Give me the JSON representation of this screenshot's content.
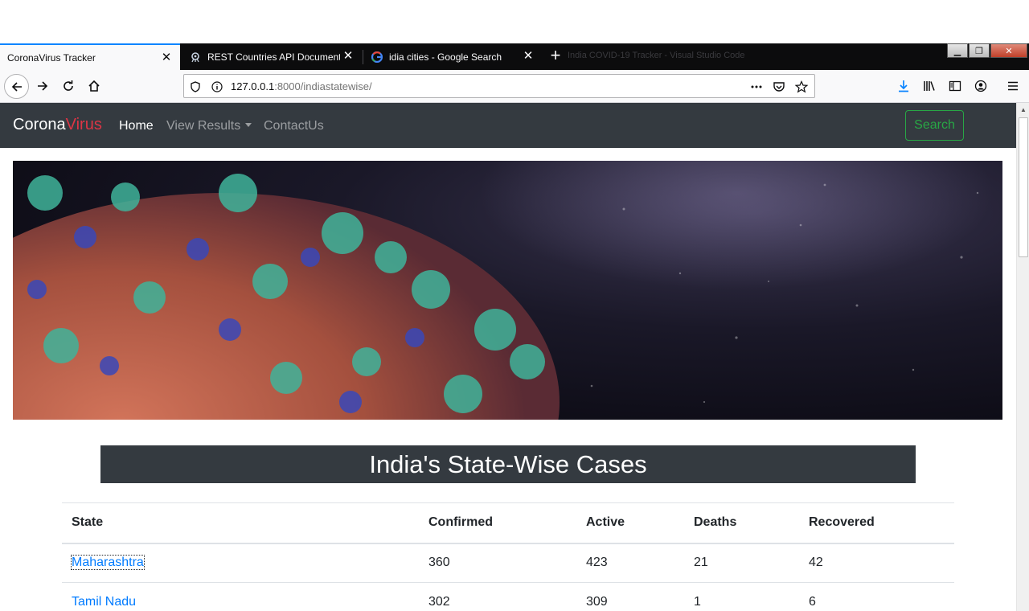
{
  "browser": {
    "tabs": [
      {
        "title": "CoronaVirus Tracker",
        "active": true,
        "icon": "none"
      },
      {
        "title": "REST Countries API Documentation",
        "active": false,
        "icon": "restcountries-icon"
      },
      {
        "title": "idia cities - Google Search",
        "active": false,
        "icon": "google-icon"
      }
    ],
    "window_title": "India COVID-19 Tracker - Visual Studio Code",
    "url_host": "127.0.0.1",
    "url_rest": ":8000/indiastatewise/"
  },
  "site": {
    "brand_part1": "Corona",
    "brand_part2": "Virus",
    "nav": {
      "home": "Home",
      "view_results": "View Results",
      "contact": "ContactUs"
    },
    "search_label": "Search",
    "heading": "India's State-Wise Cases",
    "table": {
      "columns": [
        "State",
        "Confirmed",
        "Active",
        "Deaths",
        "Recovered"
      ],
      "rows": [
        [
          "Maharashtra",
          "360",
          "423",
          "21",
          "42"
        ],
        [
          "Tamil Nadu",
          "302",
          "309",
          "1",
          "6"
        ]
      ]
    }
  },
  "colors": {
    "navbar_bg": "#343a40",
    "brand_accent": "#dc3545",
    "search_green": "#28a745",
    "link_blue": "#007bff"
  }
}
